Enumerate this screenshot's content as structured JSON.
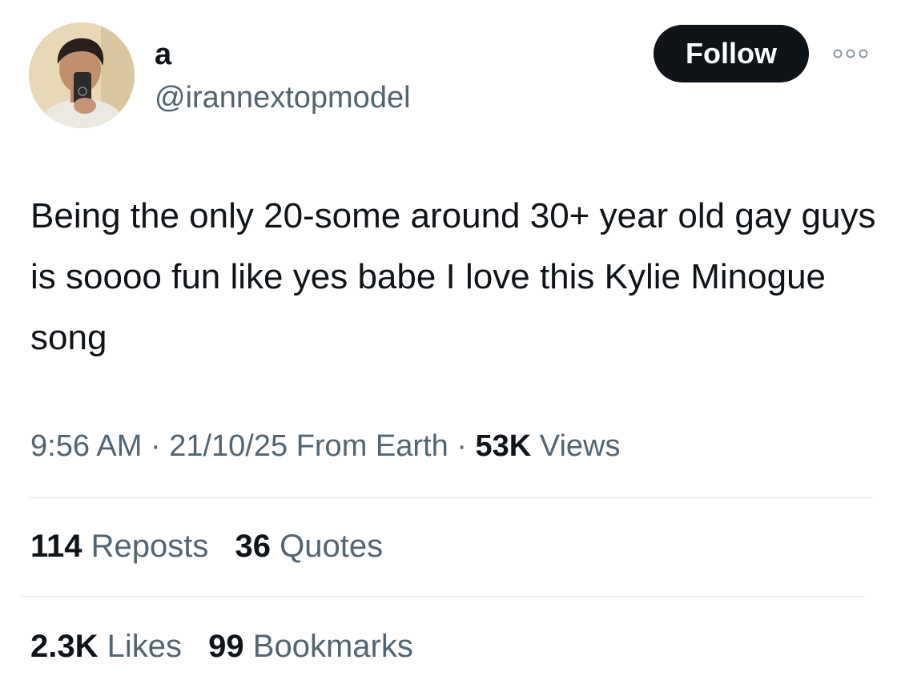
{
  "author": {
    "display_name": "a",
    "handle": "@irannextopmodel"
  },
  "header": {
    "follow_label": "Follow"
  },
  "tweet": {
    "text": "Being the only 20-some around 30+ year old gay guys is soooo fun like yes babe I love this Kylie Minogue song"
  },
  "meta": {
    "time": "9:56 AM",
    "separator": "·",
    "date": "21/10/25",
    "source": "From Earth",
    "views_count": "53K",
    "views_label": "Views"
  },
  "stats": {
    "reposts_count": "114",
    "reposts_label": "Reposts",
    "quotes_count": "36",
    "quotes_label": "Quotes",
    "likes_count": "2.3K",
    "likes_label": "Likes",
    "bookmarks_count": "99",
    "bookmarks_label": "Bookmarks"
  },
  "icons": {
    "more": "more-icon",
    "avatar": "avatar-photo"
  },
  "colors": {
    "text": "#0f1419",
    "secondary": "#536471",
    "button": "#0f1419",
    "divider": "#dfe3e6"
  }
}
